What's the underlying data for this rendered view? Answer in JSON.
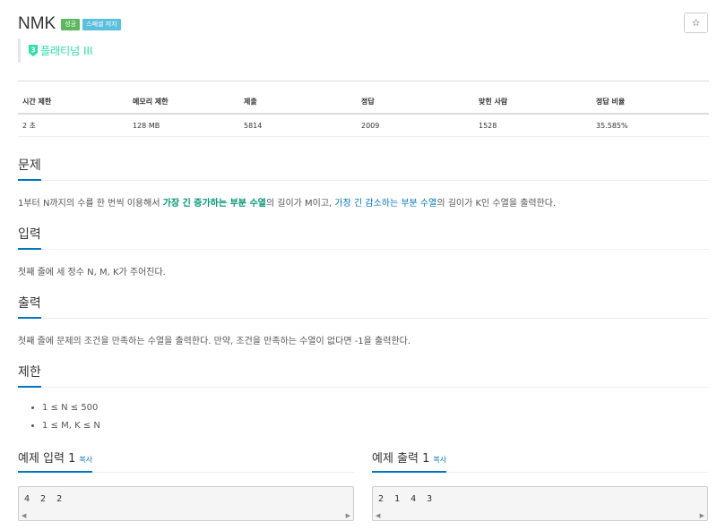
{
  "problem": {
    "title": "NMK",
    "badges": [
      "성공",
      "스페셜 저지"
    ],
    "star": "☆",
    "tier": "플래티넘 III",
    "tier_number": "3"
  },
  "info": {
    "headers": [
      "시간 제한",
      "메모리 제한",
      "제출",
      "정답",
      "맞힌 사람",
      "정답 비율"
    ],
    "values": [
      "2 초",
      "128 MB",
      "5814",
      "2009",
      "1528",
      "35.585%"
    ]
  },
  "sections": {
    "problem": {
      "title": "문제",
      "t1": "1부터 N까지의 수를 한 번씩 이용해서 ",
      "link1": "가장 긴 증가하는 부분 수열",
      "t2": "의 길이가 M이고, ",
      "link2": "가장 긴 감소하는 부분 수열",
      "t3": "의 길이가 K인 수열을 출력한다."
    },
    "input": {
      "title": "입력",
      "text": "첫째 줄에 세 정수 N, M, K가 주어진다."
    },
    "output": {
      "title": "출력",
      "text": "첫째 줄에 문제의 조건을 만족하는 수열을 출력한다. 만약, 조건을 만족하는 수열이 없다면 -1을 출력한다."
    },
    "limit": {
      "title": "제한",
      "items": [
        "1 ≤ N ≤ 500",
        "1 ≤ M, K ≤ N"
      ]
    }
  },
  "samples": {
    "input": {
      "title": "예제 입력 1",
      "copy": "복사",
      "content": "4 2 2"
    },
    "output": {
      "title": "예제 출력 1",
      "copy": "복사",
      "content": "2 1 4 3"
    }
  },
  "colors": {
    "success": "#5cb85c",
    "judge": "#5bc0de",
    "tier": "#27e2a4",
    "accent": "#0076c0",
    "highlight": "#009874"
  }
}
